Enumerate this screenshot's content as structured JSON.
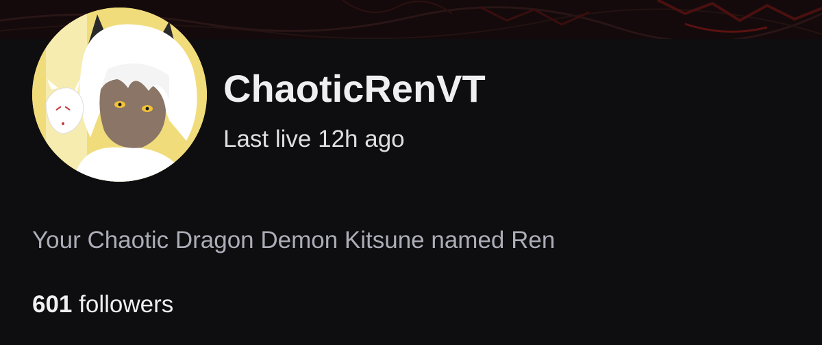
{
  "channel": {
    "name": "ChaoticRenVT",
    "last_live": "Last live 12h ago",
    "bio": "Your Chaotic Dragon Demon Kitsune named Ren",
    "followers_count": "601",
    "followers_label": "followers"
  },
  "colors": {
    "background": "#0e0e10",
    "banner": "#140a0b",
    "banner_accent": "#5a1212",
    "name_text": "#efeff1",
    "secondary_text": "#adadb8",
    "avatar_background": "#f1dc7c"
  },
  "icons": {
    "avatar": "avatar-illustration"
  }
}
